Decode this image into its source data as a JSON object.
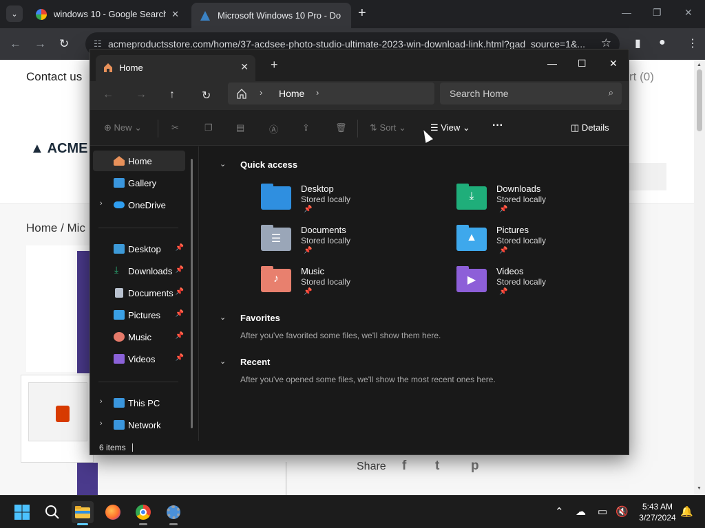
{
  "browser": {
    "tabs": [
      {
        "title": "windows 10 - Google Search"
      },
      {
        "title": "Microsoft Windows 10 Pro - Do"
      }
    ],
    "url": "acmeproductsstore.com/home/37-acdsee-photo-studio-ultimate-2023-win-download-link.html?gad_source=1&..."
  },
  "website": {
    "contact": "Contact us",
    "cart": "rt (0)",
    "logo": "ACME",
    "breadcrumb": "Home  /  Mic",
    "share": "Share",
    "social": [
      "f",
      "t",
      "p"
    ]
  },
  "explorer": {
    "tab_title": "Home",
    "address": "Home",
    "search_placeholder": "Search Home",
    "commands": {
      "new": "New",
      "sort": "Sort",
      "view": "View",
      "more": "···",
      "details": "Details"
    },
    "nav": [
      {
        "label": "Home",
        "color": "#e8915a"
      },
      {
        "label": "Gallery",
        "color": "#3a96dd"
      },
      {
        "label": "OneDrive",
        "color": "#2f9ef0"
      },
      {
        "label": "Desktop",
        "color": "#3d9ad8"
      },
      {
        "label": "Downloads",
        "color": "#2db47a"
      },
      {
        "label": "Documents",
        "color": "#b9c2cf"
      },
      {
        "label": "Pictures",
        "color": "#3aa0e6"
      },
      {
        "label": "Music",
        "color": "#e57a6a"
      },
      {
        "label": "Videos",
        "color": "#8b62d9"
      },
      {
        "label": "This PC",
        "color": "#3a96dd"
      },
      {
        "label": "Network",
        "color": "#3a96dd"
      }
    ],
    "sections": {
      "quick_access": "Quick access",
      "favorites": "Favorites",
      "favorites_msg": "After you've favorited some files, we'll show them here.",
      "recent": "Recent",
      "recent_msg": "After you've opened some files, we'll show the most recent ones here."
    },
    "quick_access": [
      {
        "name": "Desktop",
        "sub": "Stored locally",
        "color": "#2f8fe0"
      },
      {
        "name": "Downloads",
        "sub": "Stored locally",
        "color": "#1fae7a"
      },
      {
        "name": "Documents",
        "sub": "Stored locally",
        "color": "#9aa6b8"
      },
      {
        "name": "Pictures",
        "sub": "Stored locally",
        "color": "#3ea8ec"
      },
      {
        "name": "Music",
        "sub": "Stored locally",
        "color": "#e8806e"
      },
      {
        "name": "Videos",
        "sub": "Stored locally",
        "color": "#8d5fd8"
      }
    ],
    "status": "6 items"
  },
  "taskbar": {
    "time": "5:43 AM",
    "date": "3/27/2024"
  }
}
